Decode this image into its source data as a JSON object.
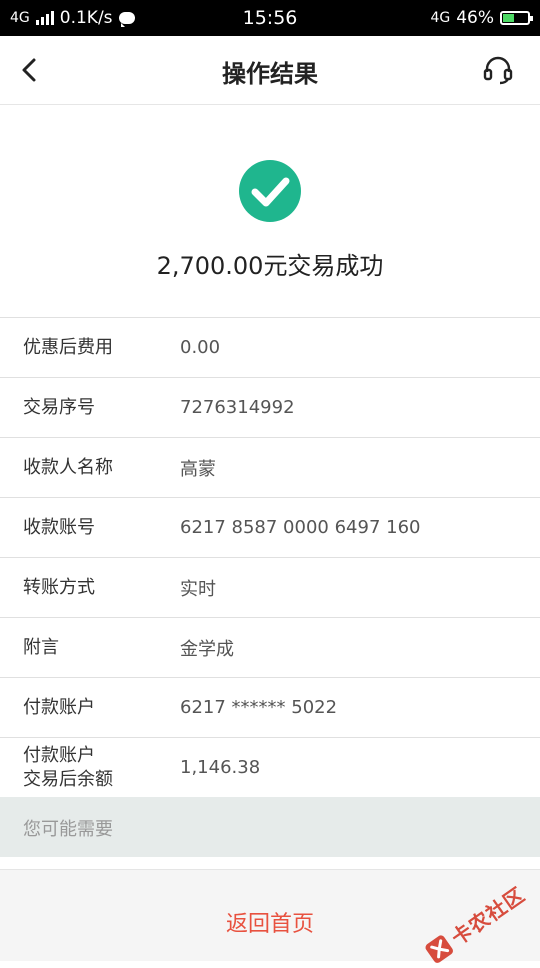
{
  "status_bar": {
    "network_left": "4G",
    "speed": "0.1K/s",
    "time": "15:56",
    "network_right": "4G",
    "battery": "46%",
    "battery_level": 0.46
  },
  "nav": {
    "title": "操作结果",
    "back_icon": "chevron-left-icon",
    "service_icon": "headset-icon"
  },
  "result": {
    "icon": "check-circle-icon",
    "text": "2,700.00元交易成功",
    "accent": "#1fb68e"
  },
  "details": [
    {
      "label": "优惠后费用",
      "value": "0.00"
    },
    {
      "label": "交易序号",
      "value": "7276314992"
    },
    {
      "label": "收款人名称",
      "value": "高蒙"
    },
    {
      "label": "收款账号",
      "value": "6217 8587 0000 6497 160"
    },
    {
      "label": "转账方式",
      "value": "实时"
    },
    {
      "label": "附言",
      "value": "金学成"
    },
    {
      "label": "付款账户",
      "value": "6217 ****** 5022"
    },
    {
      "label": "付款账户\n交易后余额",
      "value": "1,146.38"
    }
  ],
  "maybe_need": "您可能需要",
  "bottom": {
    "home_label": "返回首页",
    "accent": "#e8513f"
  },
  "watermark": {
    "text": "卡农社区"
  }
}
